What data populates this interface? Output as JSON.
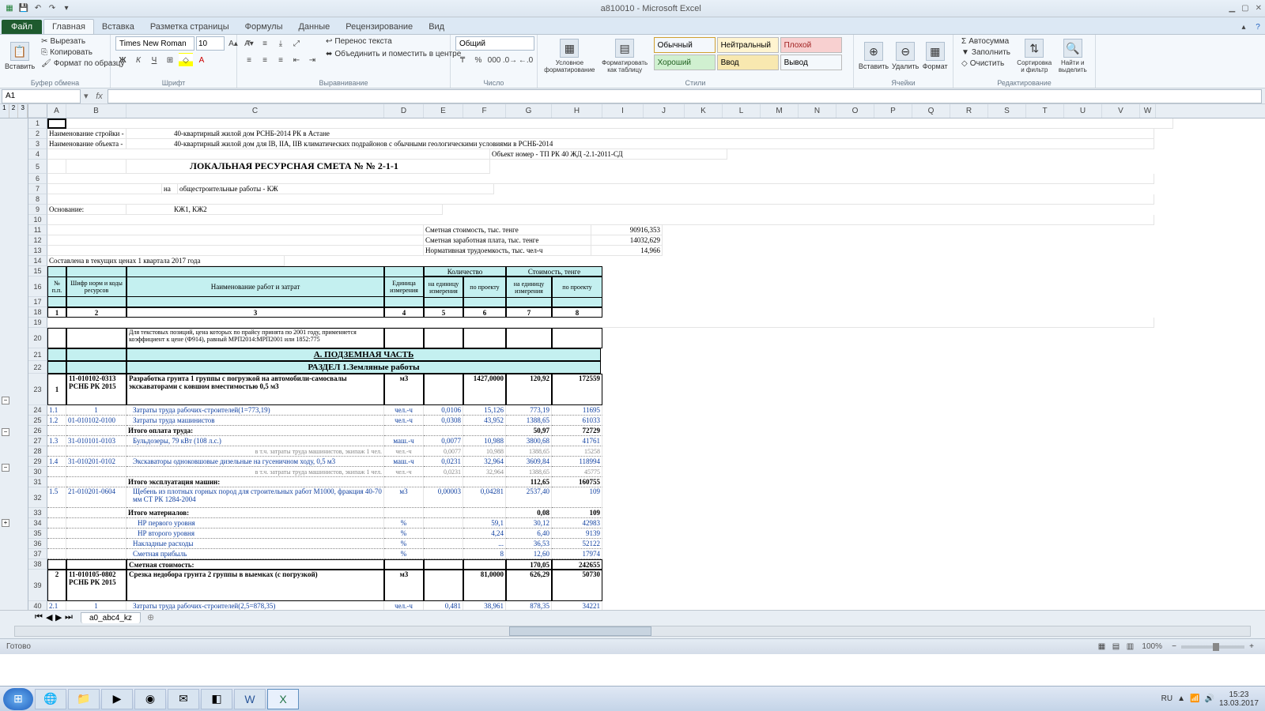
{
  "window": {
    "title": "a810010 - Microsoft Excel"
  },
  "qat": {
    "save": "💾",
    "undo": "↶",
    "redo": "↷"
  },
  "tabs": {
    "file": "Файл",
    "home": "Главная",
    "insert": "Вставка",
    "layout": "Разметка страницы",
    "formulas": "Формулы",
    "data": "Данные",
    "review": "Рецензирование",
    "view": "Вид"
  },
  "ribbon": {
    "clipboard": {
      "label": "Буфер обмена",
      "paste": "Вставить",
      "cut": "Вырезать",
      "copy": "Копировать",
      "painter": "Формат по образцу"
    },
    "font": {
      "label": "Шрифт",
      "name": "Times New Roman",
      "size": "10"
    },
    "align": {
      "label": "Выравнивание",
      "wrap": "Перенос текста",
      "merge": "Объединить и поместить в центре"
    },
    "number": {
      "label": "Число",
      "format": "Общий"
    },
    "styles": {
      "label": "Стили",
      "cond": "Условное форматирование",
      "table": "Форматировать как таблицу",
      "s1": "Обычный",
      "s2": "Нейтральный",
      "s3": "Плохой",
      "s4": "Хороший",
      "s5": "Ввод",
      "s6": "Вывод"
    },
    "cells": {
      "label": "Ячейки",
      "insert": "Вставить",
      "delete": "Удалить",
      "format": "Формат"
    },
    "editing": {
      "label": "Редактирование",
      "sum": "Автосумма",
      "fill": "Заполнить",
      "clear": "Очистить",
      "sort": "Сортировка и фильтр",
      "find": "Найти и выделить"
    }
  },
  "namebox": "A1",
  "cols": [
    "A",
    "B",
    "C",
    "D",
    "E",
    "F",
    "G",
    "H",
    "I",
    "J",
    "K",
    "L",
    "M",
    "N",
    "O",
    "P",
    "Q",
    "R",
    "S",
    "T",
    "U",
    "V",
    "W"
  ],
  "rownums": [
    "1",
    "2",
    "3",
    "4",
    "5",
    "6",
    "7",
    "8",
    "9",
    "10",
    "11",
    "12",
    "13",
    "14",
    "15",
    "16",
    "17",
    "18",
    "19",
    "20",
    "21",
    "22",
    "23",
    "24",
    "25",
    "26",
    "27",
    "28",
    "29",
    "30",
    "31",
    "32",
    "33",
    "34",
    "35",
    "36",
    "37",
    "38",
    "40"
  ],
  "doc": {
    "r2a": "Наименование стройки -",
    "r2b": "40-квартирный жилой дом РСНБ-2014 РК в Астане",
    "r3a": "Наименование объекта -",
    "r3b": "40-квартирный жилой дом для IВ, IIА, IIВ климатических подрайонов с обычными геологическими условиями в РСНБ-2014",
    "r4": "Объект номер -   ТП РК 40 ЖД -2.1-2011-СД",
    "r5": "ЛОКАЛЬНАЯ   РЕСУРСНАЯ   СМЕТА     №  № 2-1-1",
    "r7a": "на",
    "r7b": "общестроительные работы - КЖ",
    "r9a": "Основание:",
    "r9b": "КЖ1, КЖ2",
    "r11a": "Сметная стоимость, тыс. тенге",
    "r11b": "90916,353",
    "r12a": "Сметная заработная плата, тыс. тенге",
    "r12b": "14032,629",
    "r13a": "Нормативная трудоемкость, тыс. чел-ч",
    "r13b": "14,966",
    "r14": "Составлена в текущих ценах 1 квартала 2017 года",
    "hdr": {
      "npp": "№ п.п.",
      "shifr": "Шифр норм и коды ресурсов",
      "name": "Наименование работ и затрат",
      "unit": "Единица измерения",
      "qty": "Количество",
      "cost": "Стоимость, тенге",
      "perunit": "на единицу измерения",
      "perproj": "по проекту"
    },
    "numrow": {
      "c1": "1",
      "c2": "2",
      "c3": "3",
      "c4": "4",
      "c5": "5",
      "c6": "6",
      "c7": "7",
      "c8": "8"
    },
    "r20": "Для текстовых позиций, цена которых по прайсу принята по 2001 году, применяется коэффициент к цене (Ф914), равный МРП2014:МРП2001 или 1852:775",
    "r21": "А. ПОДЗЕМНАЯ ЧАСТЬ",
    "r22": "РАЗДЕЛ 1.Земляные работы",
    "item1": {
      "n": "1",
      "code": "11-010102-0313 РСНБ РК 2015",
      "name": "Разработка грунта 1 группы с погрузкой на автомобили-самосвалы экскаваторами с ковшом вместимостью 0,5 м3",
      "unit": "м3",
      "qty": "1427,0000",
      "rate": "120,92",
      "sum": "172559"
    },
    "r24": {
      "n": "1.1",
      "code": "1",
      "name": "Затраты труда рабочих-строителей(1=773,19)",
      "unit": "чел.-ч",
      "v1": "0,0106",
      "v2": "15,126",
      "v3": "773,19",
      "v4": "11695"
    },
    "r25": {
      "n": "1.2",
      "code": "01-010102-0100",
      "name": "Затраты труда машинистов",
      "unit": "чел.-ч",
      "v1": "0,0308",
      "v2": "43,952",
      "v3": "1388,65",
      "v4": "61033"
    },
    "r26": {
      "name": "Итого оплата труда:",
      "v3": "50,97",
      "v4": "72729"
    },
    "r27": {
      "n": "1.3",
      "code": "31-010101-0103",
      "name": "Бульдозеры, 79 кВт (108 л.с.)",
      "unit": "маш.-ч",
      "v1": "0,0077",
      "v2": "10,988",
      "v3": "3800,68",
      "v4": "41761"
    },
    "r28": {
      "name": "в т.ч. затраты труда машинистов, экипаж 1 чел.",
      "unit": "чел.-ч",
      "v1": "0,0077",
      "v2": "10,988",
      "v3": "1388,65",
      "v4": "15258"
    },
    "r29": {
      "n": "1.4",
      "code": "31-010201-0102",
      "name": "Экскаваторы одноковшовые дизельные на гусеничном ходу, 0,5 м3",
      "unit": "маш.-ч",
      "v1": "0,0231",
      "v2": "32,964",
      "v3": "3609,84",
      "v4": "118994"
    },
    "r30": {
      "name": "в т.ч. затраты труда машинистов, экипаж 1 чел.",
      "unit": "чел.-ч",
      "v1": "0,0231",
      "v2": "32,964",
      "v3": "1388,65",
      "v4": "45775"
    },
    "r31": {
      "name": "Итого эксплуатация машин:",
      "v3": "112,65",
      "v4": "160755"
    },
    "r32": {
      "n": "1.5",
      "code": "21-010201-0604",
      "name": "Щебень из плотных горных пород для строительных работ М1000, фракция 40-70 мм СТ РК 1284-2004",
      "unit": "м3",
      "v1": "0,00003",
      "v2": "0,04281",
      "v3": "2537,40",
      "v4": "109"
    },
    "r33": {
      "name": "Итого материалов:",
      "v3": "0,08",
      "v4": "109"
    },
    "r34": {
      "name": "НР первого уровня",
      "unit": "%",
      "v2": "59,1",
      "v3": "30,12",
      "v4": "42983"
    },
    "r35": {
      "name": "НР второго уровня",
      "unit": "%",
      "v2": "4,24",
      "v3": "6,40",
      "v4": "9139"
    },
    "r36": {
      "name": "Накладные расходы",
      "unit": "%",
      "v2": "...",
      "v3": "36,53",
      "v4": "52122"
    },
    "r37": {
      "name": "Сметная прибыль",
      "unit": "%",
      "v2": "8",
      "v3": "12,60",
      "v4": "17974"
    },
    "r38": {
      "name": "Сметная стоимость:",
      "v3": "170,05",
      "v4": "242655"
    },
    "item2": {
      "n": "2",
      "code": "11-010105-0802 РСНБ РК 2015",
      "name": "Срезка недобора грунта 2 группы в выемках (с погрузкой)",
      "unit": "м3",
      "qty": "81,0000",
      "rate": "626,29",
      "sum": "50730"
    },
    "r40": {
      "n": "2.1",
      "code": "1",
      "name": "Затраты труда рабочих-строителей(2,5=878,35)",
      "unit": "чел.-ч",
      "v1": "0,481",
      "v2": "38,961",
      "v3": "878,35",
      "v4": "34221"
    }
  },
  "sheettab": "a0_abc4_kz",
  "status": {
    "ready": "Готово",
    "zoom": "100%"
  },
  "tray": {
    "lang": "RU",
    "time": "15:23",
    "date": "13.03.2017"
  }
}
